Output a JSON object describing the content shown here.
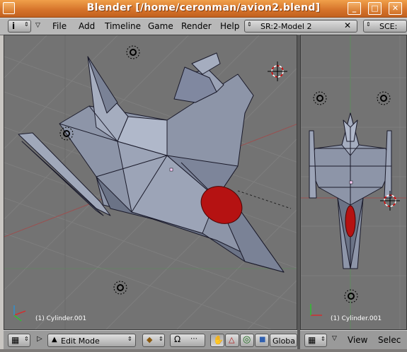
{
  "window": {
    "title": "Blender [/home/ceronman/avion2.blend]"
  },
  "menu": {
    "items": [
      "File",
      "Add",
      "Timeline",
      "Game",
      "Render",
      "Help"
    ],
    "scene_field": "SR:2-Model 2",
    "scene_field2": "SCE:",
    "close_glyph": "✕"
  },
  "left_view": {
    "object_label": "(1) Cylinder.001"
  },
  "right_view": {
    "object_label": "(1) Cylinder.001"
  },
  "left_header": {
    "mode": "Edit Mode",
    "orient": "Globa"
  },
  "right_header": {
    "view_menu": "View",
    "select_menu": "Selec"
  },
  "colors": {
    "title": "#d4722a",
    "viewport": "#737373",
    "mesh": "#8d95a8",
    "accent_red": "#c01010"
  },
  "icons": [
    "info-icon",
    "arrow-icon",
    "cube-icon",
    "snap-icon",
    "hand-icon",
    "triangle-icon",
    "ring-icon",
    "square-icon",
    "grid-icon"
  ]
}
